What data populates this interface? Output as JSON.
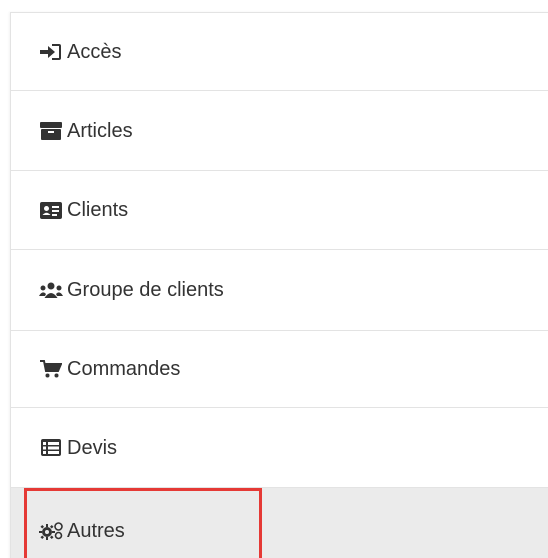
{
  "menu": {
    "items": [
      {
        "label": "Accès",
        "icon": "sign-in-icon"
      },
      {
        "label": "Articles",
        "icon": "archive-box-icon"
      },
      {
        "label": "Clients",
        "icon": "address-card-icon"
      },
      {
        "label": "Groupe de clients",
        "icon": "users-icon"
      },
      {
        "label": "Commandes",
        "icon": "shopping-cart-icon"
      },
      {
        "label": "Devis",
        "icon": "list-table-icon"
      },
      {
        "label": "Autres",
        "icon": "cogs-icon",
        "active": true
      }
    ]
  },
  "colors": {
    "text": "#333333",
    "divider": "#e3e3e3",
    "active_bg": "#ebebeb",
    "highlight": "#e53935"
  }
}
